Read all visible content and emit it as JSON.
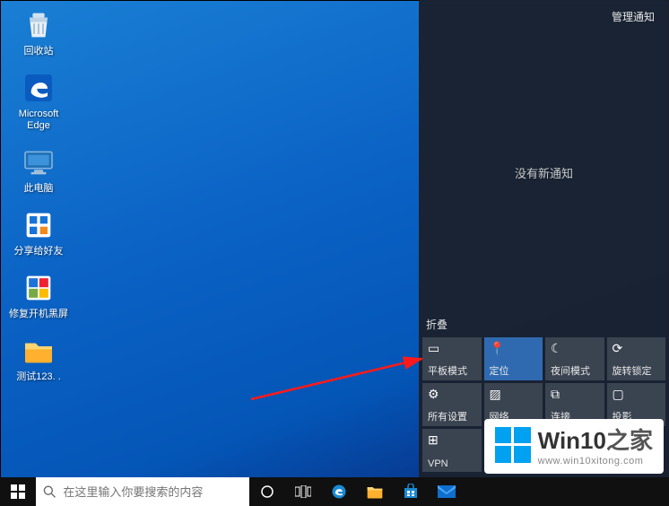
{
  "desktop": {
    "icons": [
      {
        "name": "recycle-bin",
        "label": "回收站"
      },
      {
        "name": "edge",
        "label": "Microsoft Edge"
      },
      {
        "name": "this-pc",
        "label": "此电脑"
      },
      {
        "name": "share-app",
        "label": "分享给好友"
      },
      {
        "name": "repair-app",
        "label": "修复开机黑屏"
      },
      {
        "name": "folder-test",
        "label": "测试123. ."
      }
    ]
  },
  "taskbar": {
    "search_placeholder": "在这里输入你要搜索的内容"
  },
  "action_center": {
    "manage": "管理通知",
    "empty": "没有新通知",
    "collapse": "折叠",
    "tiles": [
      {
        "label": "平板模式",
        "icon": "tablet",
        "active": false
      },
      {
        "label": "定位",
        "icon": "location",
        "active": true
      },
      {
        "label": "夜间模式",
        "icon": "moon",
        "active": false
      },
      {
        "label": "旋转锁定",
        "icon": "rotation",
        "active": false
      },
      {
        "label": "所有设置",
        "icon": "settings",
        "active": false
      },
      {
        "label": "网络",
        "icon": "network",
        "active": false
      },
      {
        "label": "连接",
        "icon": "connect",
        "active": false
      },
      {
        "label": "投影",
        "icon": "project",
        "active": false
      },
      {
        "label": "VPN",
        "icon": "vpn",
        "active": false
      }
    ]
  },
  "watermark": {
    "brand": "Win10",
    "suffix": "之家",
    "url": "www.win10xitong.com"
  },
  "colors": {
    "desktop_gradient_start": "#1a7fd4",
    "desktop_gradient_end": "#0a1e6a",
    "taskbar": "#101010",
    "action_center": "#19222f",
    "tile": "#3a4350",
    "tile_active": "#2f6ab0",
    "arrow": "#ff1a1a"
  }
}
